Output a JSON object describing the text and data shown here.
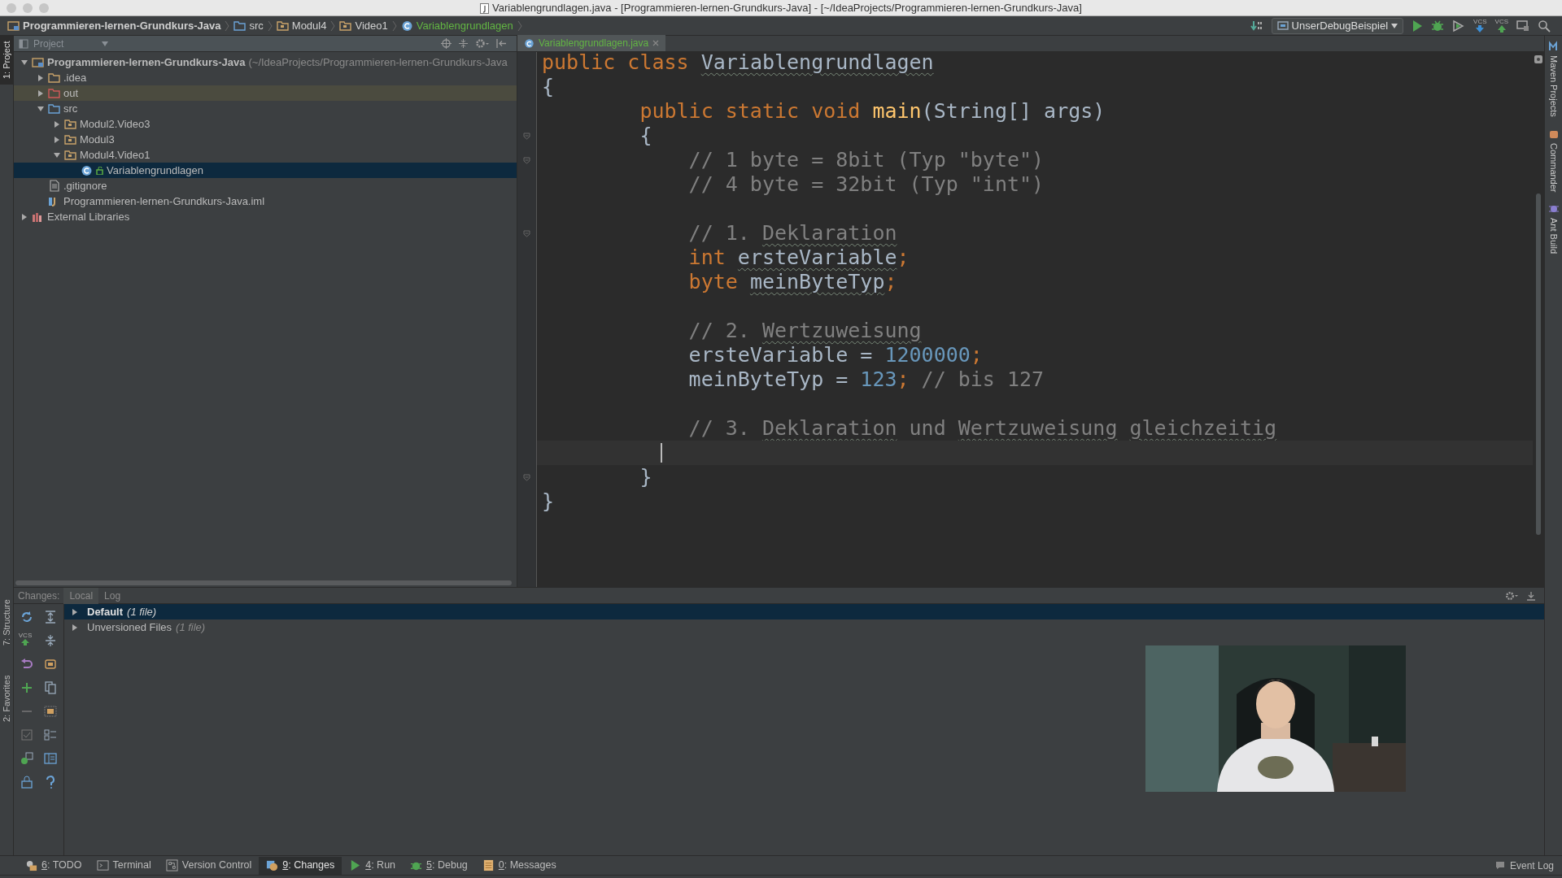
{
  "window": {
    "title": "Variablengrundlagen.java - [Programmieren-lernen-Grundkurs-Java] - [~/IdeaProjects/Programmieren-lernen-Grundkurs-Java]"
  },
  "navigation_bar": {
    "breadcrumbs": [
      {
        "label": "Programmieren-lernen-Grundkurs-Java",
        "kind": "project"
      },
      {
        "label": "src",
        "kind": "source"
      },
      {
        "label": "Modul4",
        "kind": "package"
      },
      {
        "label": "Video1",
        "kind": "package"
      },
      {
        "label": "Variablengrundlagen",
        "kind": "class"
      }
    ],
    "run_configuration": "UnserDebugBeispiel",
    "vcs_update_label": "VCS",
    "vcs_commit_label": "VCS"
  },
  "left_strip": [
    {
      "label": "1: Project",
      "selected": true
    },
    {
      "label": "7: Structure",
      "selected": false
    },
    {
      "label": "2: Favorites",
      "selected": false
    }
  ],
  "right_strip": [
    {
      "label": "Maven Projects"
    },
    {
      "label": "Commander"
    },
    {
      "label": "Ant Build"
    }
  ],
  "project_panel": {
    "title": "Project",
    "tree": [
      {
        "label": "Programmieren-lernen-Grundkurs-Java",
        "note": "(~/IdeaProjects/Programmieren-lernen-Grundkurs-Java",
        "kind": "project",
        "expanded": true,
        "selected": false,
        "children": [
          {
            "label": ".idea",
            "kind": "folder",
            "expanded": false,
            "selected": false
          },
          {
            "label": "out",
            "kind": "excluded",
            "expanded": false,
            "selected": false
          },
          {
            "label": "src",
            "kind": "source",
            "expanded": true,
            "selected": false,
            "children": [
              {
                "label": "Modul2.Video3",
                "kind": "package",
                "expanded": false,
                "selected": false
              },
              {
                "label": "Modul3",
                "kind": "package",
                "expanded": false,
                "selected": false
              },
              {
                "label": "Modul4.Video1",
                "kind": "package",
                "expanded": true,
                "selected": false,
                "children": [
                  {
                    "label": "Variablengrundlagen",
                    "kind": "class",
                    "selected": true
                  }
                ]
              }
            ]
          },
          {
            "label": ".gitignore",
            "kind": "file",
            "selected": false
          },
          {
            "label": "Programmieren-lernen-Grundkurs-Java.iml",
            "kind": "module",
            "selected": false
          }
        ]
      },
      {
        "label": "External Libraries",
        "kind": "libraries",
        "expanded": false,
        "selected": false
      }
    ]
  },
  "editor": {
    "tabs": [
      {
        "label": "Variablengrundlagen.java",
        "selected": true
      }
    ],
    "lines": [
      {
        "kind": "code",
        "tokens": [
          {
            "text": "public class ",
            "kind": "keyword"
          },
          {
            "text": "Variablengrundlagen",
            "kind": "plain",
            "typo": true
          }
        ]
      },
      {
        "kind": "code",
        "tokens": [
          {
            "text": "{",
            "kind": "plain"
          }
        ]
      },
      {
        "kind": "code",
        "tokens": [
          {
            "text": "        public static void ",
            "kind": "keyword"
          },
          {
            "text": "main",
            "kind": "function"
          },
          {
            "text": "(String[] args)",
            "kind": "plain"
          }
        ]
      },
      {
        "kind": "code",
        "fold": true,
        "tokens": [
          {
            "text": "        {",
            "kind": "plain"
          }
        ]
      },
      {
        "kind": "code",
        "fold": true,
        "tokens": [
          {
            "text": "            // 1 byte = 8bit (Typ \"byte\")",
            "kind": "comment"
          }
        ]
      },
      {
        "kind": "code",
        "tokens": [
          {
            "text": "            // 4 byte = 32bit (Typ \"int\")",
            "kind": "comment"
          }
        ]
      },
      {
        "kind": "blank"
      },
      {
        "kind": "code",
        "fold": true,
        "tokens": [
          {
            "text": "            // 1. ",
            "kind": "comment"
          },
          {
            "text": "Deklaration",
            "kind": "comment",
            "typo": true
          }
        ]
      },
      {
        "kind": "code",
        "tokens": [
          {
            "text": "            int ",
            "kind": "keyword"
          },
          {
            "text": "ersteVariable",
            "kind": "plain",
            "typo": true
          },
          {
            "text": ";",
            "kind": "keyword"
          }
        ]
      },
      {
        "kind": "code",
        "tokens": [
          {
            "text": "            byte ",
            "kind": "keyword"
          },
          {
            "text": "meinByteTyp",
            "kind": "plain",
            "typo": true
          },
          {
            "text": ";",
            "kind": "keyword"
          }
        ]
      },
      {
        "kind": "blank"
      },
      {
        "kind": "code",
        "tokens": [
          {
            "text": "            // 2. ",
            "kind": "comment"
          },
          {
            "text": "Wertzuweisung",
            "kind": "comment",
            "typo": true
          }
        ]
      },
      {
        "kind": "code",
        "tokens": [
          {
            "text": "            ersteVariable = ",
            "kind": "plain"
          },
          {
            "text": "1200000",
            "kind": "number"
          },
          {
            "text": ";",
            "kind": "keyword"
          }
        ]
      },
      {
        "kind": "code",
        "tokens": [
          {
            "text": "            meinByteTyp = ",
            "kind": "plain"
          },
          {
            "text": "123",
            "kind": "number"
          },
          {
            "text": ";",
            "kind": "keyword"
          },
          {
            "text": " // bis 127",
            "kind": "comment"
          }
        ]
      },
      {
        "kind": "blank"
      },
      {
        "kind": "code",
        "tokens": [
          {
            "text": "            // 3. ",
            "kind": "comment"
          },
          {
            "text": "Deklaration",
            "kind": "comment",
            "typo": true
          },
          {
            "text": " und ",
            "kind": "comment"
          },
          {
            "text": "Wertzuweisung",
            "kind": "comment",
            "typo": true
          },
          {
            "text": " gleichzeitig",
            "kind": "comment",
            "typo": true
          }
        ]
      },
      {
        "kind": "blank",
        "current": true
      },
      {
        "kind": "code",
        "fold": true,
        "tokens": [
          {
            "text": "        }",
            "kind": "plain"
          }
        ]
      },
      {
        "kind": "code",
        "tokens": [
          {
            "text": "}",
            "kind": "plain"
          }
        ]
      }
    ]
  },
  "changes_panel": {
    "title": "Changes:",
    "tabs": [
      {
        "label": "Local",
        "selected": true
      },
      {
        "label": "Log",
        "selected": false
      }
    ],
    "vcs_label": "VCS",
    "lists": [
      {
        "name": "Default",
        "note": "(1 file)",
        "active": true,
        "selected": true
      },
      {
        "name": "Unversioned Files",
        "note": "(1 file)",
        "active": false,
        "selected": false
      }
    ]
  },
  "tool_windows": [
    {
      "key": "6",
      "label": ": TODO",
      "selected": false
    },
    {
      "label": "Terminal",
      "selected": false
    },
    {
      "label": "Version Control",
      "selected": false
    },
    {
      "key": "9",
      "label": ": Changes",
      "selected": true
    },
    {
      "key": "4",
      "label": ": Run",
      "selected": false
    },
    {
      "key": "5",
      "label": ": Debug",
      "selected": false
    },
    {
      "key": "0",
      "label": ": Messages",
      "selected": false
    }
  ],
  "event_log": "Event Log"
}
